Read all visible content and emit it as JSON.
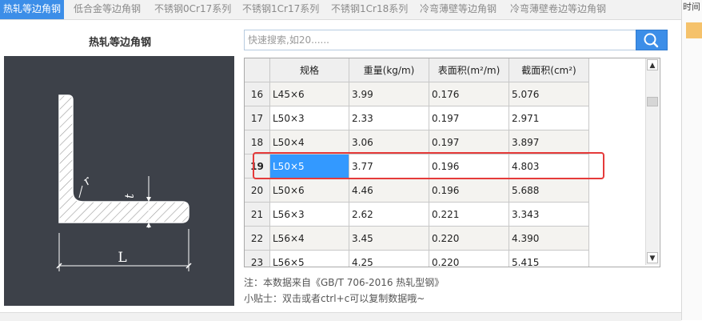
{
  "tabs": [
    {
      "label": "热轧等边角钢",
      "active": true
    },
    {
      "label": "低合金等边角钢"
    },
    {
      "label": "不锈钢0Cr17系列"
    },
    {
      "label": "不锈钢1Cr17系列"
    },
    {
      "label": "不锈钢1Cr18系列"
    },
    {
      "label": "冷弯薄壁等边角钢"
    },
    {
      "label": "冷弯薄壁卷边等边角钢"
    }
  ],
  "side_panel": {
    "label": "时间"
  },
  "diagram": {
    "title": "热轧等边角钢",
    "labels": {
      "r": "r",
      "t": "t",
      "L": "L"
    }
  },
  "search": {
    "placeholder": "快速搜索,如20......",
    "icon": "search-icon"
  },
  "table": {
    "columns": [
      "规格",
      "重量(kg/m)",
      "表面积(m²/m)",
      "截面积(cm²)"
    ],
    "rows": [
      {
        "no": "16",
        "spec": "L45×6",
        "weight": "3.99",
        "surface": "0.176",
        "section": "5.076"
      },
      {
        "no": "17",
        "spec": "L50×3",
        "weight": "2.33",
        "surface": "0.197",
        "section": "2.971"
      },
      {
        "no": "18",
        "spec": "L50×4",
        "weight": "3.06",
        "surface": "0.197",
        "section": "3.897"
      },
      {
        "no": "19",
        "spec": "L50×5",
        "weight": "3.77",
        "surface": "0.196",
        "section": "4.803"
      },
      {
        "no": "20",
        "spec": "L50×6",
        "weight": "4.46",
        "surface": "0.196",
        "section": "5.688"
      },
      {
        "no": "21",
        "spec": "L56×3",
        "weight": "2.62",
        "surface": "0.221",
        "section": "3.343"
      },
      {
        "no": "22",
        "spec": "L56×4",
        "weight": "3.45",
        "surface": "0.220",
        "section": "4.390"
      },
      {
        "no": "23",
        "spec": "L56×5",
        "weight": "4.25",
        "surface": "0.220",
        "section": "5.415"
      }
    ],
    "selected_row": "19",
    "selected_column": "spec"
  },
  "scrollbar": {
    "up": "▲",
    "down": "▼"
  },
  "notes": {
    "source": "注：本数据来自《GB/T 706-2016  热轧型钢》",
    "tip": "小贴士：双击或者ctrl+c可以复制数据哦~"
  },
  "colors": {
    "accent": "#3c8ee8",
    "selection": "#3399ff",
    "highlight": "#e53a3a",
    "diagram_bg": "#3d4149"
  }
}
